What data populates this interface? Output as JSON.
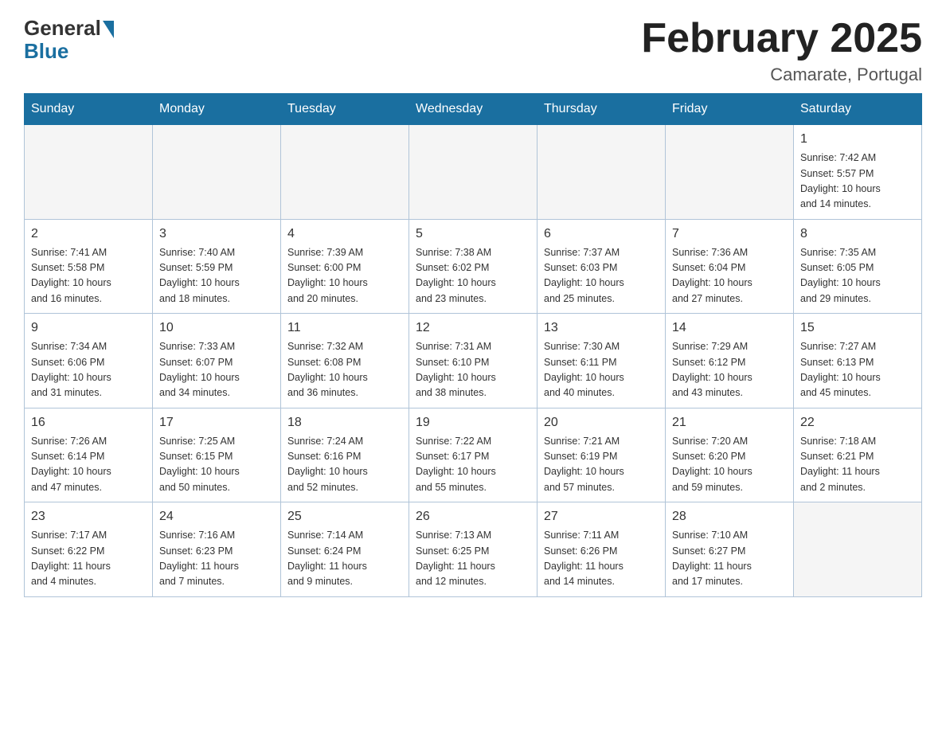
{
  "logo": {
    "general": "General",
    "blue": "Blue"
  },
  "header": {
    "month_year": "February 2025",
    "location": "Camarate, Portugal"
  },
  "weekdays": [
    "Sunday",
    "Monday",
    "Tuesday",
    "Wednesday",
    "Thursday",
    "Friday",
    "Saturday"
  ],
  "weeks": [
    [
      {
        "day": "",
        "info": ""
      },
      {
        "day": "",
        "info": ""
      },
      {
        "day": "",
        "info": ""
      },
      {
        "day": "",
        "info": ""
      },
      {
        "day": "",
        "info": ""
      },
      {
        "day": "",
        "info": ""
      },
      {
        "day": "1",
        "info": "Sunrise: 7:42 AM\nSunset: 5:57 PM\nDaylight: 10 hours\nand 14 minutes."
      }
    ],
    [
      {
        "day": "2",
        "info": "Sunrise: 7:41 AM\nSunset: 5:58 PM\nDaylight: 10 hours\nand 16 minutes."
      },
      {
        "day": "3",
        "info": "Sunrise: 7:40 AM\nSunset: 5:59 PM\nDaylight: 10 hours\nand 18 minutes."
      },
      {
        "day": "4",
        "info": "Sunrise: 7:39 AM\nSunset: 6:00 PM\nDaylight: 10 hours\nand 20 minutes."
      },
      {
        "day": "5",
        "info": "Sunrise: 7:38 AM\nSunset: 6:02 PM\nDaylight: 10 hours\nand 23 minutes."
      },
      {
        "day": "6",
        "info": "Sunrise: 7:37 AM\nSunset: 6:03 PM\nDaylight: 10 hours\nand 25 minutes."
      },
      {
        "day": "7",
        "info": "Sunrise: 7:36 AM\nSunset: 6:04 PM\nDaylight: 10 hours\nand 27 minutes."
      },
      {
        "day": "8",
        "info": "Sunrise: 7:35 AM\nSunset: 6:05 PM\nDaylight: 10 hours\nand 29 minutes."
      }
    ],
    [
      {
        "day": "9",
        "info": "Sunrise: 7:34 AM\nSunset: 6:06 PM\nDaylight: 10 hours\nand 31 minutes."
      },
      {
        "day": "10",
        "info": "Sunrise: 7:33 AM\nSunset: 6:07 PM\nDaylight: 10 hours\nand 34 minutes."
      },
      {
        "day": "11",
        "info": "Sunrise: 7:32 AM\nSunset: 6:08 PM\nDaylight: 10 hours\nand 36 minutes."
      },
      {
        "day": "12",
        "info": "Sunrise: 7:31 AM\nSunset: 6:10 PM\nDaylight: 10 hours\nand 38 minutes."
      },
      {
        "day": "13",
        "info": "Sunrise: 7:30 AM\nSunset: 6:11 PM\nDaylight: 10 hours\nand 40 minutes."
      },
      {
        "day": "14",
        "info": "Sunrise: 7:29 AM\nSunset: 6:12 PM\nDaylight: 10 hours\nand 43 minutes."
      },
      {
        "day": "15",
        "info": "Sunrise: 7:27 AM\nSunset: 6:13 PM\nDaylight: 10 hours\nand 45 minutes."
      }
    ],
    [
      {
        "day": "16",
        "info": "Sunrise: 7:26 AM\nSunset: 6:14 PM\nDaylight: 10 hours\nand 47 minutes."
      },
      {
        "day": "17",
        "info": "Sunrise: 7:25 AM\nSunset: 6:15 PM\nDaylight: 10 hours\nand 50 minutes."
      },
      {
        "day": "18",
        "info": "Sunrise: 7:24 AM\nSunset: 6:16 PM\nDaylight: 10 hours\nand 52 minutes."
      },
      {
        "day": "19",
        "info": "Sunrise: 7:22 AM\nSunset: 6:17 PM\nDaylight: 10 hours\nand 55 minutes."
      },
      {
        "day": "20",
        "info": "Sunrise: 7:21 AM\nSunset: 6:19 PM\nDaylight: 10 hours\nand 57 minutes."
      },
      {
        "day": "21",
        "info": "Sunrise: 7:20 AM\nSunset: 6:20 PM\nDaylight: 10 hours\nand 59 minutes."
      },
      {
        "day": "22",
        "info": "Sunrise: 7:18 AM\nSunset: 6:21 PM\nDaylight: 11 hours\nand 2 minutes."
      }
    ],
    [
      {
        "day": "23",
        "info": "Sunrise: 7:17 AM\nSunset: 6:22 PM\nDaylight: 11 hours\nand 4 minutes."
      },
      {
        "day": "24",
        "info": "Sunrise: 7:16 AM\nSunset: 6:23 PM\nDaylight: 11 hours\nand 7 minutes."
      },
      {
        "day": "25",
        "info": "Sunrise: 7:14 AM\nSunset: 6:24 PM\nDaylight: 11 hours\nand 9 minutes."
      },
      {
        "day": "26",
        "info": "Sunrise: 7:13 AM\nSunset: 6:25 PM\nDaylight: 11 hours\nand 12 minutes."
      },
      {
        "day": "27",
        "info": "Sunrise: 7:11 AM\nSunset: 6:26 PM\nDaylight: 11 hours\nand 14 minutes."
      },
      {
        "day": "28",
        "info": "Sunrise: 7:10 AM\nSunset: 6:27 PM\nDaylight: 11 hours\nand 17 minutes."
      },
      {
        "day": "",
        "info": ""
      }
    ]
  ]
}
